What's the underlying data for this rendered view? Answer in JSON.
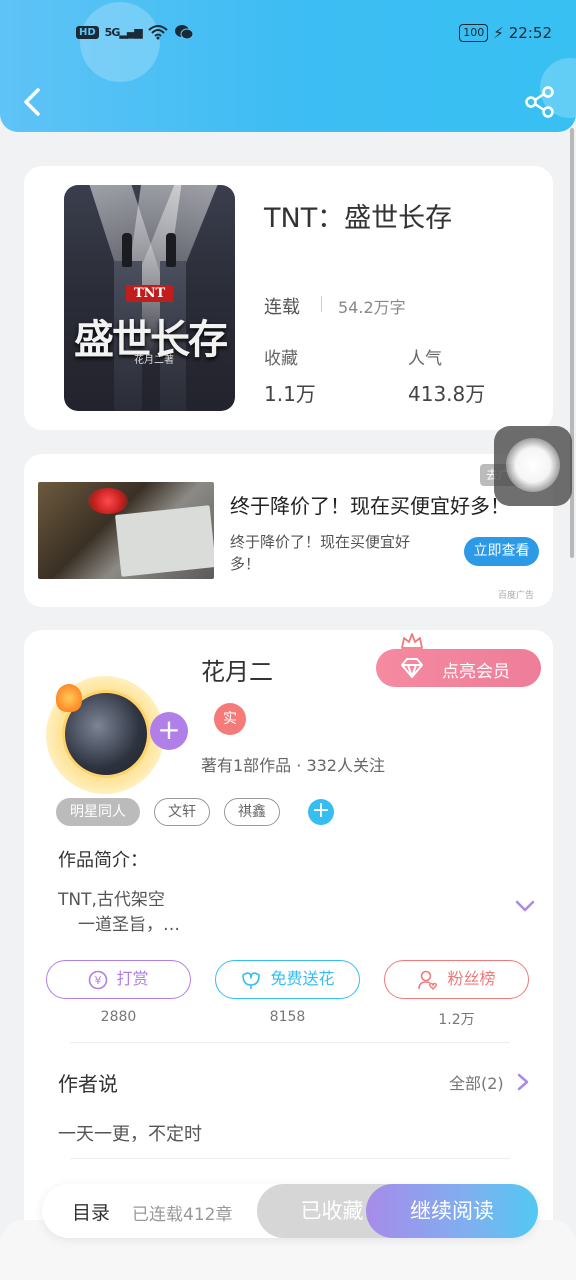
{
  "status": {
    "hd": "HD",
    "network": "5G",
    "battery": "100",
    "time": "22:52"
  },
  "book": {
    "title": "TNT：盛世长存",
    "status": "连载",
    "words": "54.2万字",
    "collect_label": "收藏",
    "collect_value": "1.1万",
    "popularity_label": "人气",
    "popularity_value": "413.8万",
    "cover": {
      "tag": "TNT",
      "title": "盛世长存",
      "author": "花月二著"
    }
  },
  "ad": {
    "title": "终于降价了！现在买便宜好多！",
    "desc": "终于降价了！现在买便宜好多！",
    "button": "立即查看",
    "tag": "去广告",
    "source": "百度广告"
  },
  "author": {
    "name": "花月二",
    "badge": "实",
    "stats": "著有1部作品 · 332人关注",
    "vip_button": "点亮会员",
    "tags": [
      "明星同人",
      "文轩",
      "祺鑫"
    ],
    "intro_title": "作品简介：",
    "intro_line1": "TNT,古代架空",
    "intro_line2": "一道圣旨，…",
    "actions": [
      {
        "label": "打赏",
        "count": "2880",
        "color": "#b07fe8"
      },
      {
        "label": "免费送花",
        "count": "8158",
        "color": "#38bdf0"
      },
      {
        "label": "粉丝榜",
        "count": "1.2万",
        "color": "#f07a7a"
      }
    ],
    "say_title": "作者说",
    "say_all": "全部(2)",
    "say_text": "一天一更，不定时"
  },
  "bottom": {
    "toc": "目录",
    "chapters": "已连载412章",
    "collected": "已收藏",
    "read": "继续阅读"
  },
  "colors": {
    "header": "#3dbdf3",
    "accent_purple": "#b07fe8",
    "accent_blue": "#38bdf0",
    "accent_red": "#f07a7a"
  }
}
